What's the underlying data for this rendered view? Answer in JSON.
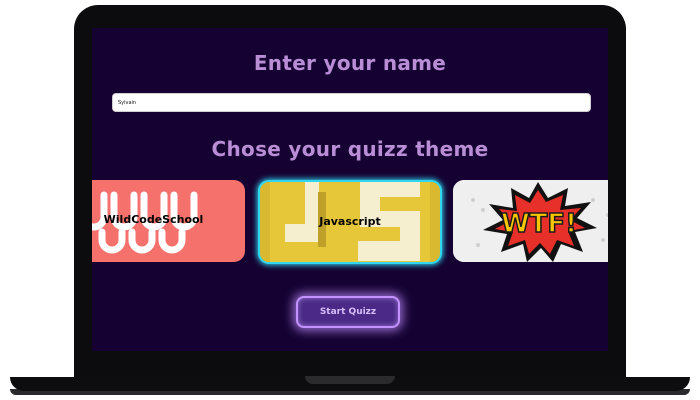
{
  "name_section": {
    "heading": "Enter your name",
    "input_value": "Sylvain"
  },
  "theme_section": {
    "heading": "Chose your quizz theme",
    "themes": [
      {
        "label": "WildCodeSchool",
        "color": "#f4716c"
      },
      {
        "label": "Javascript",
        "color": "#d8b92f",
        "selected": true
      },
      {
        "label": "",
        "image_text": "WTF!",
        "color": "#efefef"
      }
    ]
  },
  "start_button": {
    "label": "Start Quizz"
  },
  "colors": {
    "background": "#150232",
    "heading": "#b98ed6",
    "selected_border": "#2fd8f0",
    "button_glow": "#c392ff"
  }
}
